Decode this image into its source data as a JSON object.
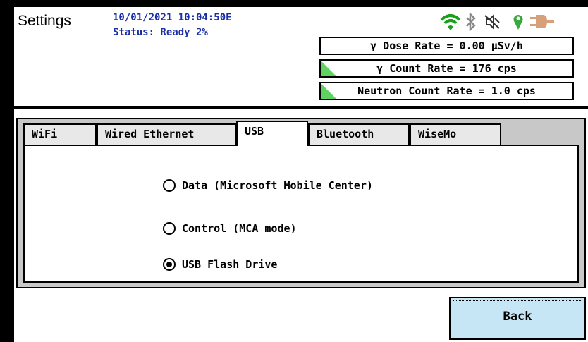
{
  "header": {
    "title": "Settings",
    "datetime": "10/01/2021 10:04:50E",
    "status": "Status: Ready 2%"
  },
  "icons": [
    "wifi-icon",
    "bluetooth-icon",
    "mute-icon",
    "gps-pin-icon",
    "power-plug-icon"
  ],
  "rates": {
    "dose": "γ Dose Rate = 0.00  µSv/h",
    "gamma_count": "γ Count Rate = 176 cps",
    "neutron_count": "Neutron Count Rate = 1.0 cps"
  },
  "tabs": [
    "WiFi",
    "Wired Ethernet",
    "USB",
    "Bluetooth",
    "WiseMo"
  ],
  "active_tab": "USB",
  "usb_options": {
    "data": "Data (Microsoft Mobile Center)",
    "control": "Control (MCA mode)",
    "flash": "USB Flash Drive",
    "selected": "USB Flash Drive"
  },
  "back_label": "Back",
  "colors": {
    "accent_text": "#1a2fa6",
    "wifi": "#1aa01a",
    "gps": "#3aa83a",
    "plug": "#d8a07a",
    "indicator": "#5fd35f",
    "button": "#c7e6f5"
  }
}
